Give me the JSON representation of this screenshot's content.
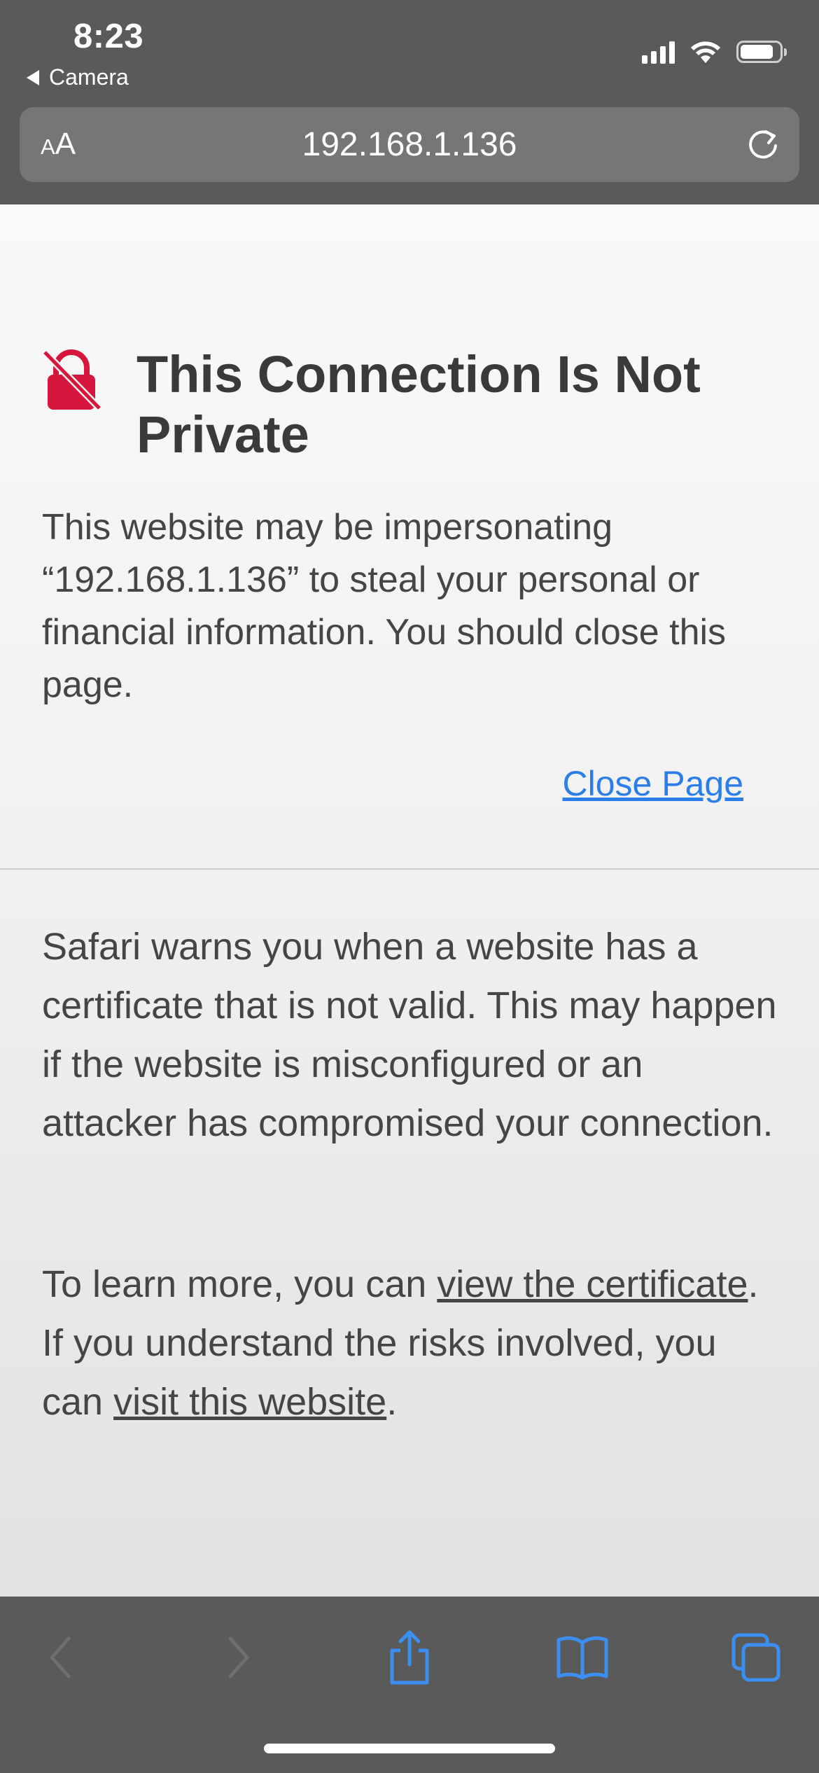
{
  "status_bar": {
    "time": "8:23",
    "back_app": "Camera",
    "battery_level": 0.85
  },
  "address_bar": {
    "aa_small": "A",
    "aa_large": "A",
    "url": "192.168.1.136"
  },
  "page": {
    "title": "This Connection Is Not Private",
    "warning": "This website may be impersonating “192.168.1.136” to steal your personal or financial information. You should close this page.",
    "close_link": "Close Page",
    "explanation": "Safari warns you when a website has a certificate that is not valid. This may happen if the website is misconfigured or an attacker has compromised your connection.",
    "learn_prefix": "To learn more, you can ",
    "view_certificate_link": "view the certificate",
    "learn_middle": ". If you understand the risks involved, you can ",
    "visit_website_link": "visit this website",
    "learn_suffix": "."
  },
  "colors": {
    "chrome": "#5a5a5a",
    "accent": "#2b7de9",
    "alert_red": "#d6163c",
    "text": "#454545"
  },
  "toolbar": {
    "icons": [
      "back-icon",
      "forward-icon",
      "share-icon",
      "bookmarks-icon",
      "tabs-icon"
    ]
  }
}
